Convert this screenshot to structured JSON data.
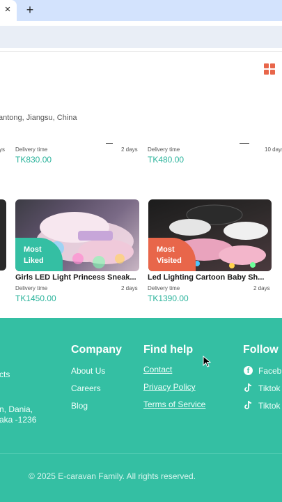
{
  "browser": {
    "tab_close": "×",
    "new_tab": "+"
  },
  "page": {
    "grid_icon": "grid-view-icon",
    "location_text": "antong, Jiangsu, China",
    "row1": {
      "left_days": "ys",
      "card1": {
        "delivery_label": "Delivery time",
        "days": "2 days",
        "price": "TK830.00"
      },
      "card2": {
        "delivery_label": "Delivery time",
        "days": "10 days",
        "price": "TK480.00"
      }
    },
    "row2": {
      "card1": {
        "badge": "Most Liked",
        "title": "Girls LED Light Princess Sneak...",
        "delivery_label": "Delivery time",
        "days": "2 days",
        "price": "TK1450.00"
      },
      "card2": {
        "badge": "Most Visited",
        "title": "Led Lighting Cartoon Baby Sh...",
        "delivery_label": "Delivery time",
        "days": "2 days",
        "price": "TK1390.00"
      }
    }
  },
  "footer": {
    "left_partial": {
      "line1": "cts",
      "line2": "n, Dania,",
      "line3": "aka -1236"
    },
    "company": {
      "heading": "Company",
      "links": [
        "About Us",
        "Careers",
        "Blog"
      ]
    },
    "help": {
      "heading": "Find help",
      "links": [
        "Contact",
        "Privacy Policy",
        "Terms of Service"
      ]
    },
    "follow": {
      "heading": "Follow U",
      "links": [
        "Faceb",
        "Tiktok",
        "Tiktok"
      ]
    },
    "copyright": "© 2025 E-caravan Family. All rights reserved."
  },
  "colors": {
    "accent": "#34bfa3",
    "price": "#2ab39b",
    "orange": "#e8664a",
    "tabbar": "#d3e3fd"
  }
}
